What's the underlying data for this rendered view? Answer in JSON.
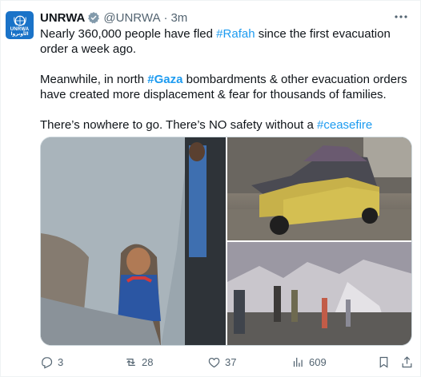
{
  "tweet": {
    "author": {
      "name": "UNRWA",
      "handle": "@UNRWA",
      "avatar_text": "UNRWA",
      "avatar_subtext": "الأونروا"
    },
    "time": "3m",
    "separator": "·",
    "paragraphs": [
      [
        {
          "text": "Nearly 360,000 people have fled "
        },
        {
          "text": "#Rafah",
          "hashtag": true
        },
        {
          "text": " since the first evacuation order a week ago."
        }
      ],
      [
        {
          "text": "Meanwhile, in north "
        },
        {
          "text": "#Gaza",
          "hashtag": true,
          "bold": true
        },
        {
          "text": " bombardments & other evacuation orders have created more displacement & fear for thousands of families."
        }
      ],
      [
        {
          "text": "There’s nowhere to go. There’s NO safety without a "
        },
        {
          "text": "#ceasefire",
          "hashtag": true
        }
      ]
    ],
    "actions": {
      "replies": "3",
      "retweets": "28",
      "likes": "37",
      "views": "609"
    }
  },
  "colors": {
    "accent": "#1d9bf0",
    "muted": "#536471",
    "unrwa_blue": "#1a73c8"
  },
  "icons": [
    "verified-icon",
    "more-icon",
    "reply-icon",
    "retweet-icon",
    "like-icon",
    "views-icon",
    "bookmark-icon",
    "share-icon"
  ]
}
